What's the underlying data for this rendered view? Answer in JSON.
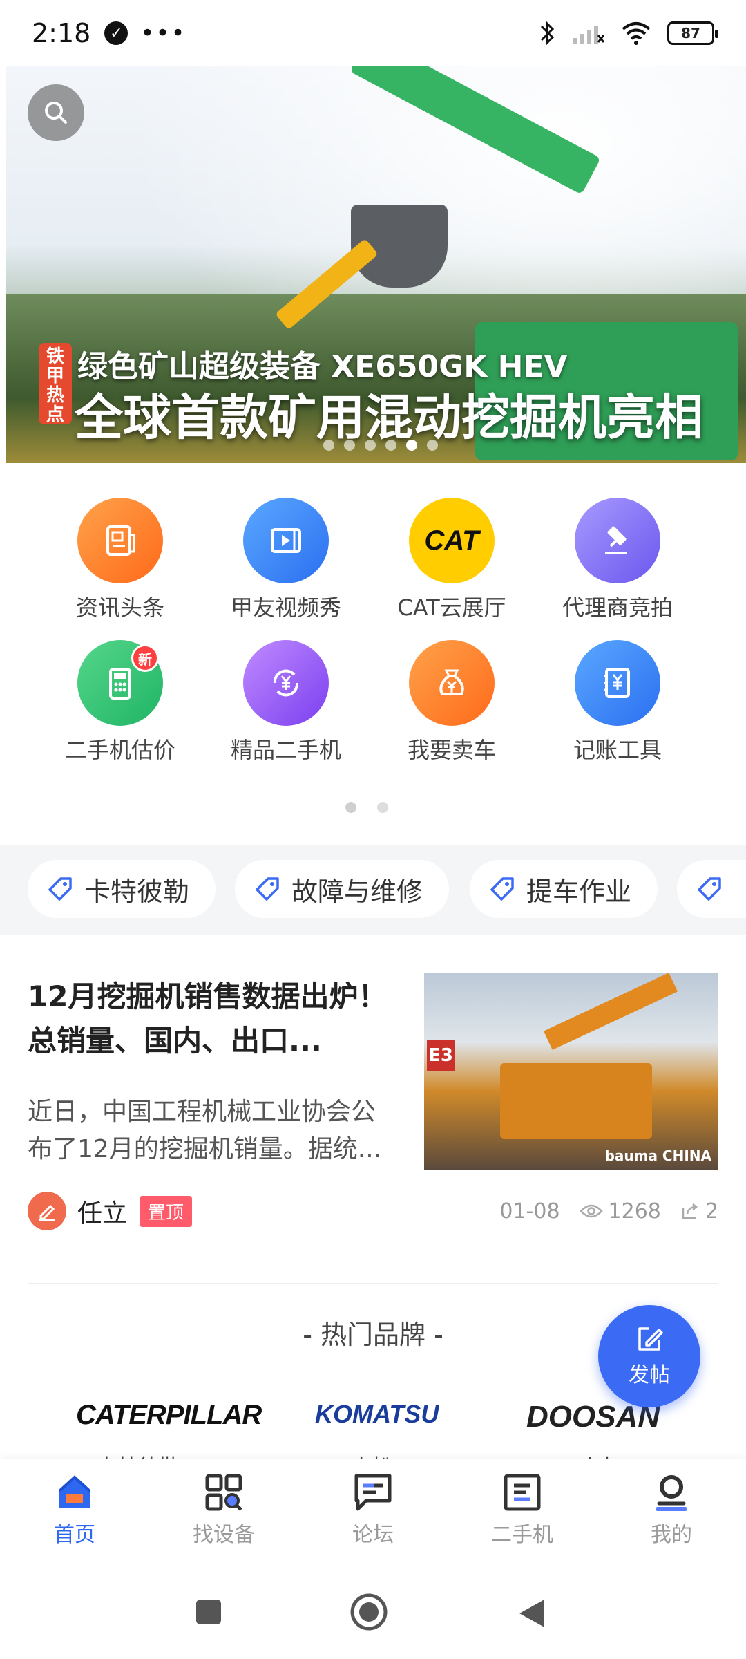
{
  "status_bar": {
    "time": "2:18",
    "battery": "87"
  },
  "banner": {
    "tag": "铁甲热点",
    "line1": "绿色矿山超级装备 XE650GK HEV",
    "line2": "全球首款矿用混动挖掘机亮相",
    "dots_count": 6,
    "active_dot": 4
  },
  "shortcuts": [
    {
      "label": "资讯头条",
      "icon": "news-icon"
    },
    {
      "label": "甲友视频秀",
      "icon": "video-icon"
    },
    {
      "label": "CAT云展厅",
      "icon": "cat-logo-icon",
      "logo_text": "CAT"
    },
    {
      "label": "代理商竞拍",
      "icon": "auction-gavel-icon"
    },
    {
      "label": "二手机估价",
      "icon": "calculator-icon",
      "badge": "新"
    },
    {
      "label": "精品二手机",
      "icon": "yuan-refresh-icon"
    },
    {
      "label": "我要卖车",
      "icon": "money-bag-icon"
    },
    {
      "label": "记账工具",
      "icon": "ledger-icon"
    }
  ],
  "tags": [
    "卡特彼勒",
    "故障与维修",
    "提车作业"
  ],
  "article": {
    "title": "12月挖掘机销售数据出炉！总销量、国内、出口...",
    "summary": "近日，中国工程机械工业协会公布了12月的挖掘机销量。据统...",
    "image_badge": "E3",
    "image_watermark": "bauma CHINA",
    "author": "任立",
    "pin_label": "置顶",
    "date": "01-08",
    "views": "1268",
    "shares": "2"
  },
  "hot_brands": {
    "title": "- 热门品牌 -",
    "brands": [
      {
        "logo": "CATERPILLAR",
        "name": "卡特彼勒"
      },
      {
        "logo": "KOMATSU",
        "name": "小松"
      },
      {
        "logo": "DOOSAN",
        "name": "斗山"
      }
    ]
  },
  "fab": {
    "label": "发帖"
  },
  "tabbar": [
    {
      "label": "首页",
      "icon": "home-icon",
      "active": true
    },
    {
      "label": "找设备",
      "icon": "find-equipment-icon",
      "active": false
    },
    {
      "label": "论坛",
      "icon": "forum-icon",
      "active": false
    },
    {
      "label": "二手机",
      "icon": "used-machine-icon",
      "active": false
    },
    {
      "label": "我的",
      "icon": "profile-icon",
      "active": false
    }
  ],
  "colors": {
    "accent": "#2f68f0",
    "fab": "#3b6bf5",
    "pin": "#ff5b6a"
  }
}
